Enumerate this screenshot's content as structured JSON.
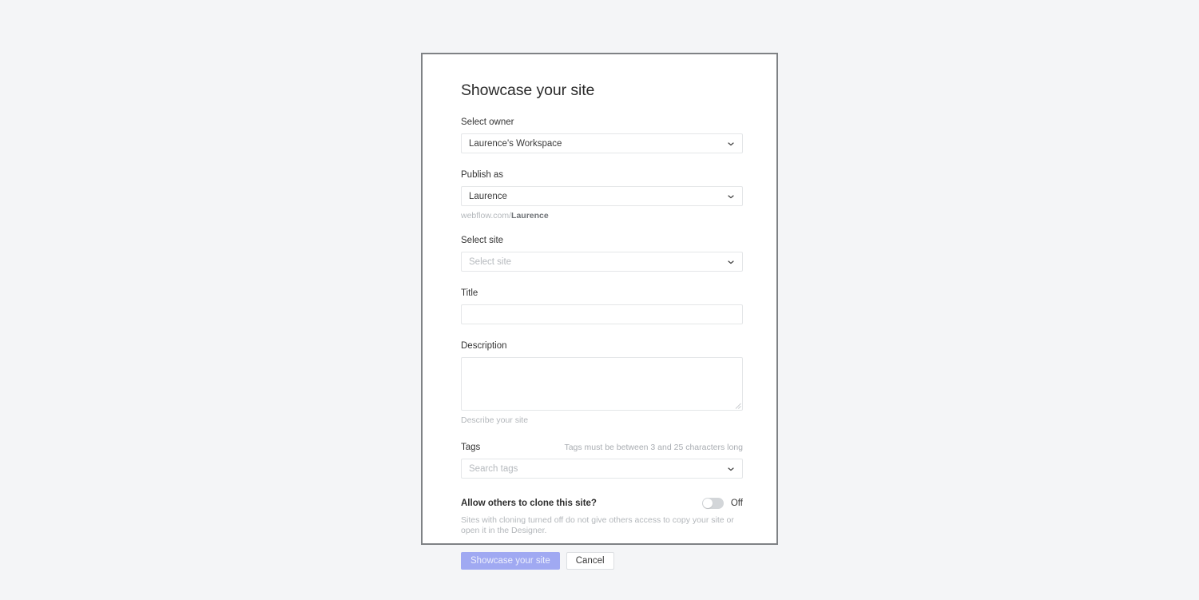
{
  "modal": {
    "title": "Showcase your site",
    "fields": {
      "owner": {
        "label": "Select owner",
        "value": "Laurence's Workspace",
        "icon": "chevron-down-icon"
      },
      "publish_as": {
        "label": "Publish as",
        "value": "Laurence",
        "icon": "chevron-down-icon",
        "url_prefix": "webflow.com/",
        "url_handle": "Laurence"
      },
      "site": {
        "label": "Select site",
        "value": "",
        "placeholder": "Select site",
        "icon": "chevron-down-icon"
      },
      "title": {
        "label": "Title",
        "value": "",
        "placeholder": ""
      },
      "description": {
        "label": "Description",
        "value": "",
        "placeholder": "",
        "help": "Describe your site"
      },
      "tags": {
        "label": "Tags",
        "hint": "Tags must be between 3 and 25 characters long",
        "value": "",
        "placeholder": "Search tags",
        "icon": "chevron-down-icon"
      }
    },
    "clone_toggle": {
      "question": "Allow others to clone this site?",
      "state_label": "Off",
      "enabled": false,
      "description": "Sites with cloning turned off do not give others access to copy your site or open it in the Designer."
    },
    "actions": {
      "primary_label": "Showcase your site",
      "primary_disabled": true,
      "secondary_label": "Cancel"
    }
  },
  "colors": {
    "page_background": "#f4f5f7",
    "card_background": "#ffffff",
    "card_border": "#7f8285",
    "input_border": "#e4e6e8",
    "label_text": "#333333",
    "placeholder_text": "#b6babe",
    "help_text": "#b3b7bb",
    "primary_button_disabled": "#a0a9f2",
    "primary_button_text": "#edeffd",
    "toggle_track_off": "#d3d6d9"
  }
}
